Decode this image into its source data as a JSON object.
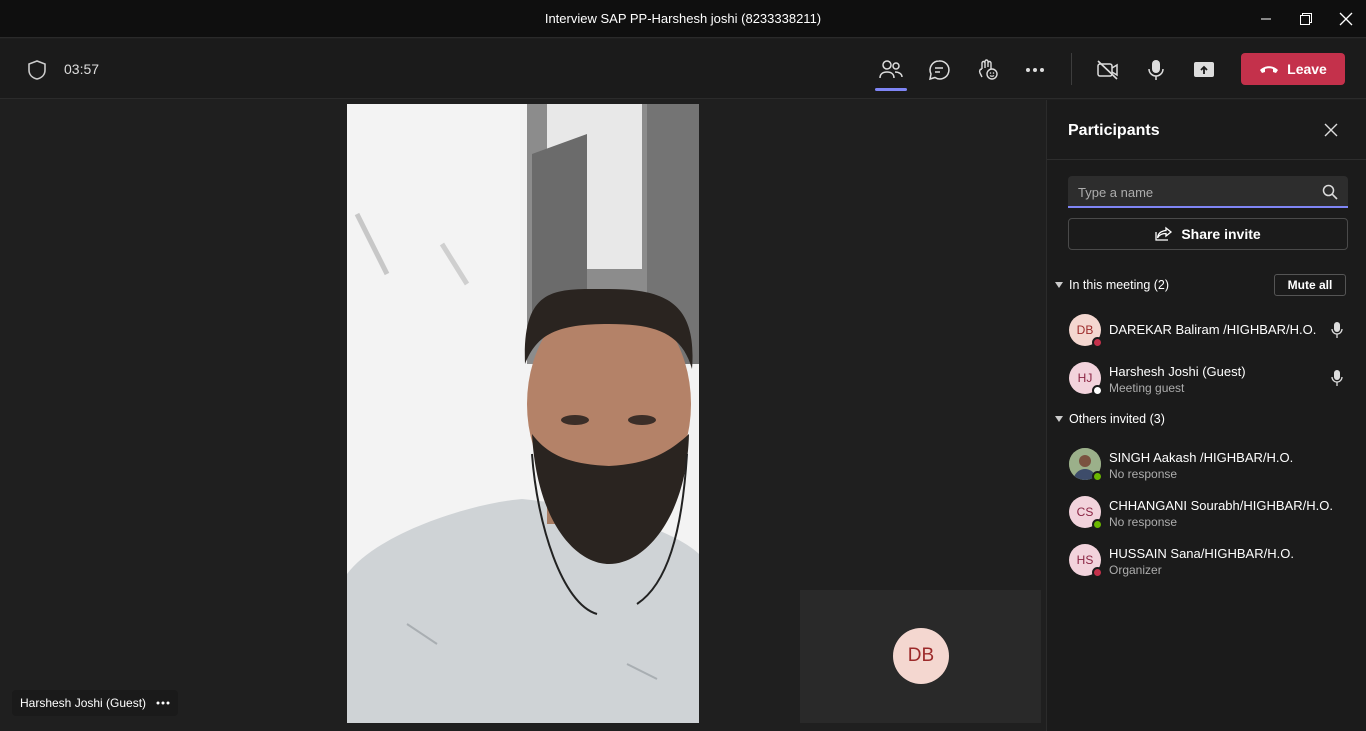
{
  "window": {
    "title": "Interview SAP PP-Harshesh joshi (8233338211)",
    "controls": [
      "minimize-icon",
      "restore-icon",
      "close-icon"
    ]
  },
  "toolbar": {
    "timer": "03:57",
    "leave_label": "Leave",
    "buttons": [
      "people-icon",
      "chat-icon",
      "reactions-icon",
      "more-icon",
      "camera-off-icon",
      "microphone-icon",
      "share-screen-icon"
    ]
  },
  "stage": {
    "speaker_name": "Harshesh Joshi (Guest)",
    "self_initials": "DB"
  },
  "participants": {
    "title": "Participants",
    "search_placeholder": "Type a name",
    "share_invite_label": "Share invite",
    "in_meeting_label": "In this meeting (2)",
    "mute_all_label": "Mute all",
    "in_meeting": [
      {
        "initials": "DB",
        "name": "DAREKAR Baliram /HIGHBAR/H.O.",
        "sub": "",
        "status": "busy",
        "avatar_bg": "#f4d7d0",
        "avatar_fg": "#9c2a2a"
      },
      {
        "initials": "HJ",
        "name": "Harshesh Joshi (Guest)",
        "sub": "Meeting guest",
        "status": "unknown",
        "avatar_bg": "#f2d3dc",
        "avatar_fg": "#8a2443"
      }
    ],
    "others_label": "Others invited (3)",
    "others": [
      {
        "initials": "",
        "name": "SINGH Aakash /HIGHBAR/H.O.",
        "sub": "No response",
        "status": "available",
        "avatar_bg": "#7a8a6a",
        "avatar_fg": "#ffffff"
      },
      {
        "initials": "CS",
        "name": "CHHANGANI Sourabh/HIGHBAR/H.O.",
        "sub": "No response",
        "status": "available",
        "avatar_bg": "#f2d3dc",
        "avatar_fg": "#8a2443"
      },
      {
        "initials": "HS",
        "name": "HUSSAIN Sana/HIGHBAR/H.O.",
        "sub": "Organizer",
        "status": "busy",
        "avatar_bg": "#f2d3dc",
        "avatar_fg": "#8a2443"
      }
    ]
  },
  "colors": {
    "accent": "#7f85f5",
    "leave": "#c4314b",
    "busy": "#c4314b",
    "available": "#6bb700"
  }
}
